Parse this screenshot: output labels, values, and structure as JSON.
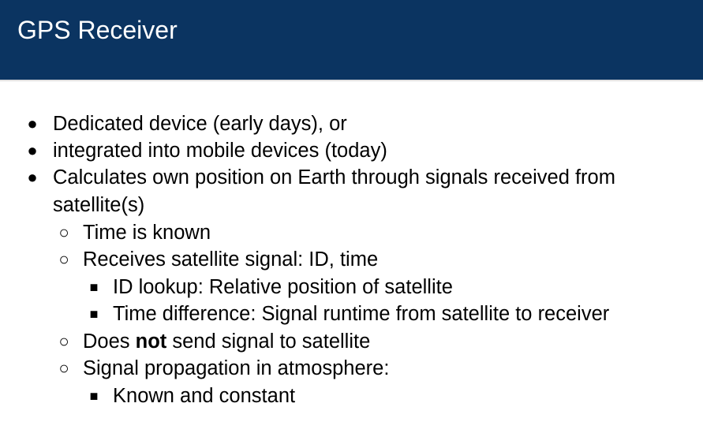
{
  "slide": {
    "title": "GPS Receiver"
  },
  "bullets": {
    "b1": "Dedicated device (early days), or",
    "b2": "integrated into mobile devices (today)",
    "b3_line1": "Calculates own position on Earth through signals received from",
    "b3_line2": "satellite(s)",
    "b3_1": "Time is known",
    "b3_2": "Receives satellite signal: ID, time",
    "b3_2_1": "ID lookup: Relative position of satellite",
    "b3_2_2": "Time difference: Signal runtime from satellite to receiver",
    "b3_3_pre": "Does ",
    "b3_3_bold": "not",
    "b3_3_post": " send signal to satellite",
    "b3_4": "Signal propagation in atmosphere:",
    "b3_4_1": "Known and constant"
  },
  "markers": {
    "level1": "●",
    "level2": "○",
    "level3": "■"
  }
}
